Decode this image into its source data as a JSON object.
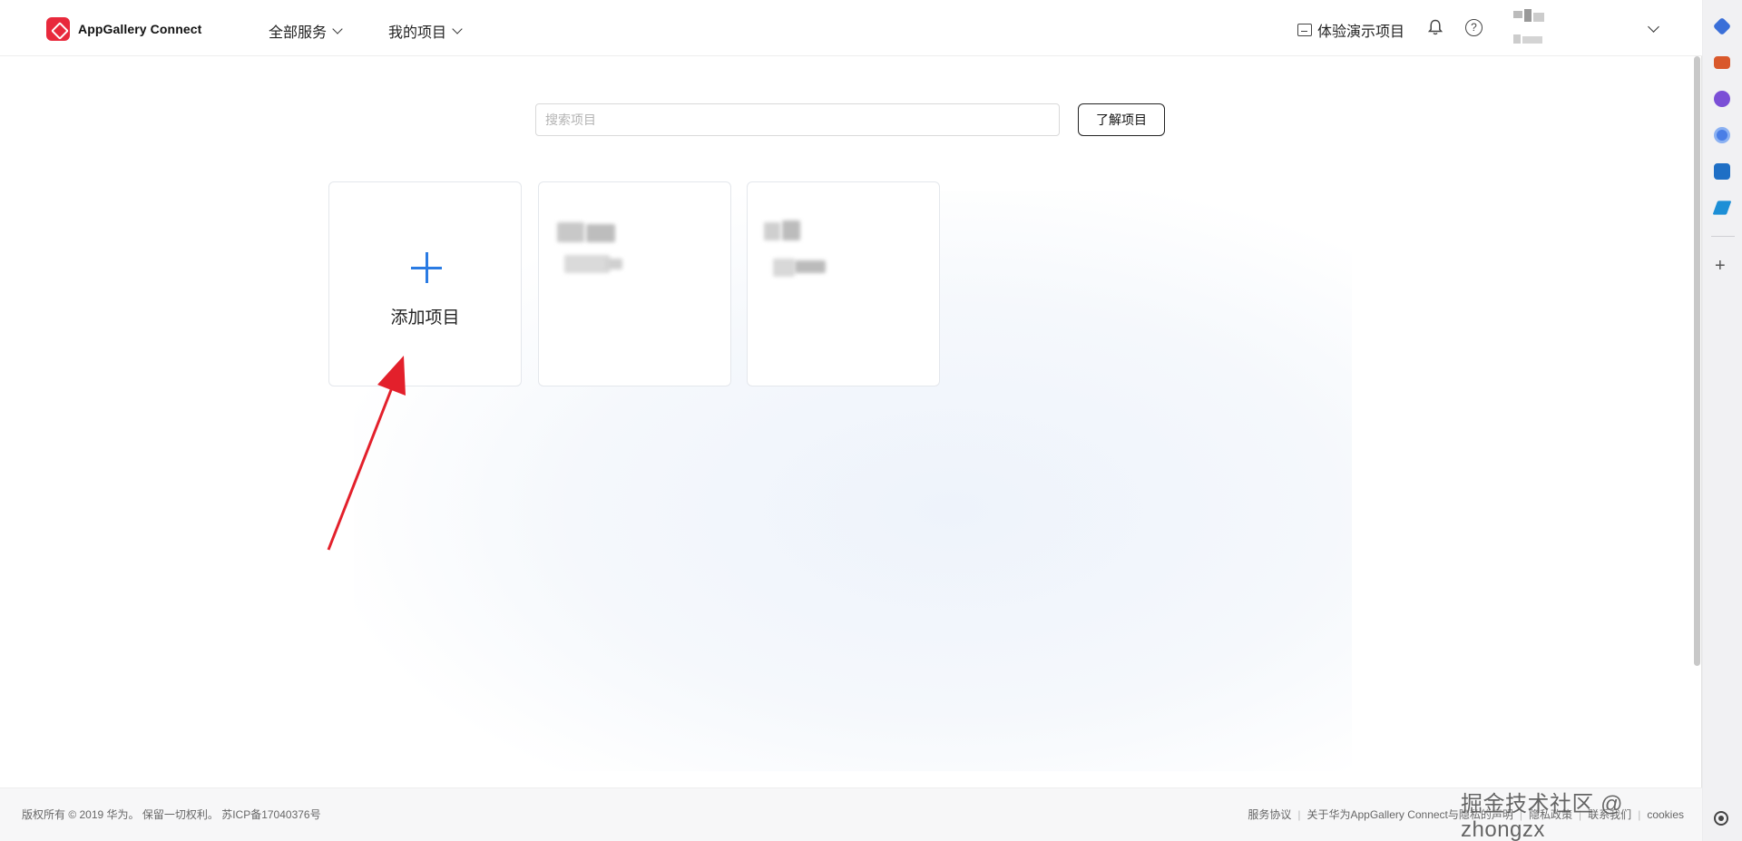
{
  "header": {
    "brand": "AppGallery Connect",
    "nav_all_services": "全部服务",
    "nav_my_projects": "我的项目",
    "demo_project": "体验演示项目"
  },
  "search": {
    "placeholder": "搜索项目",
    "learn_button": "了解项目"
  },
  "projects": {
    "add_label": "添加项目"
  },
  "footer": {
    "copyright": "版权所有 © 2019 华为。 保留一切权利。 苏ICP备17040376号",
    "links": [
      "服务协议",
      "关于华为AppGallery Connect与隐私的声明",
      "隐私政策",
      "联系我们",
      "cookies"
    ]
  },
  "watermark": "掘金技术社区 @ zhongzx",
  "colors": {
    "brand": "#e8293c",
    "accent_blue": "#2a7be3",
    "annotation_arrow": "#e3202b"
  },
  "icons": {
    "logo": "appgallery-logo-icon",
    "demo": "demo-project-icon",
    "bell": "bell-icon",
    "help": "help-icon",
    "chevron": "chevron-down-icon",
    "plus": "plus-icon"
  }
}
